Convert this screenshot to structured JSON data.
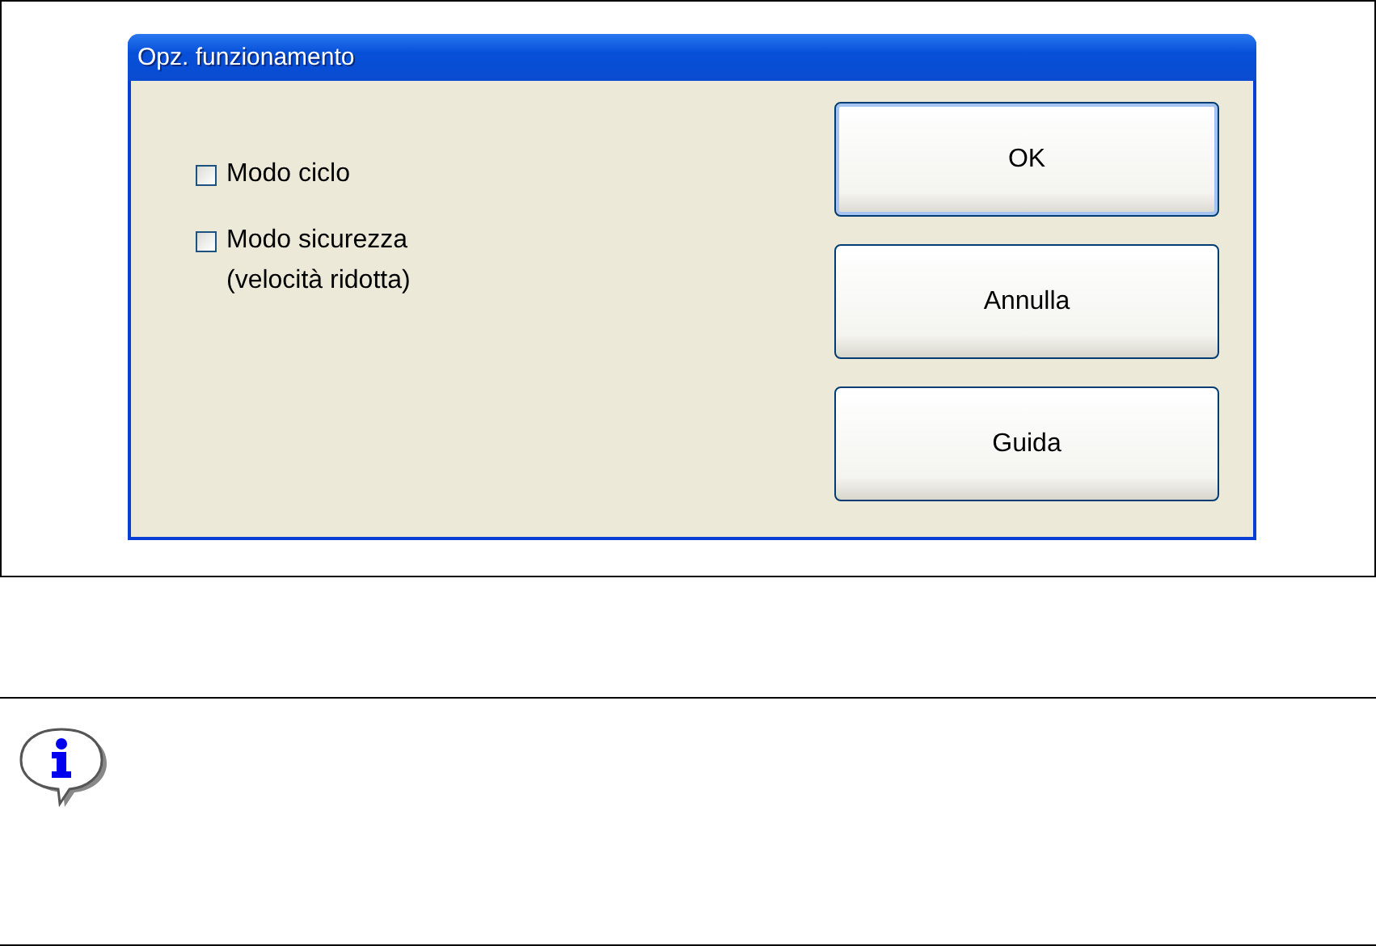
{
  "dialog": {
    "title": "Opz. funzionamento",
    "options": [
      {
        "label": "Modo ciclo",
        "checked": false
      },
      {
        "label": "Modo sicurezza\n(velocità ridotta)",
        "checked": false
      }
    ],
    "buttons": [
      {
        "label": "OK",
        "default": true
      },
      {
        "label": "Annulla",
        "default": false
      },
      {
        "label": "Guida",
        "default": false
      }
    ]
  }
}
